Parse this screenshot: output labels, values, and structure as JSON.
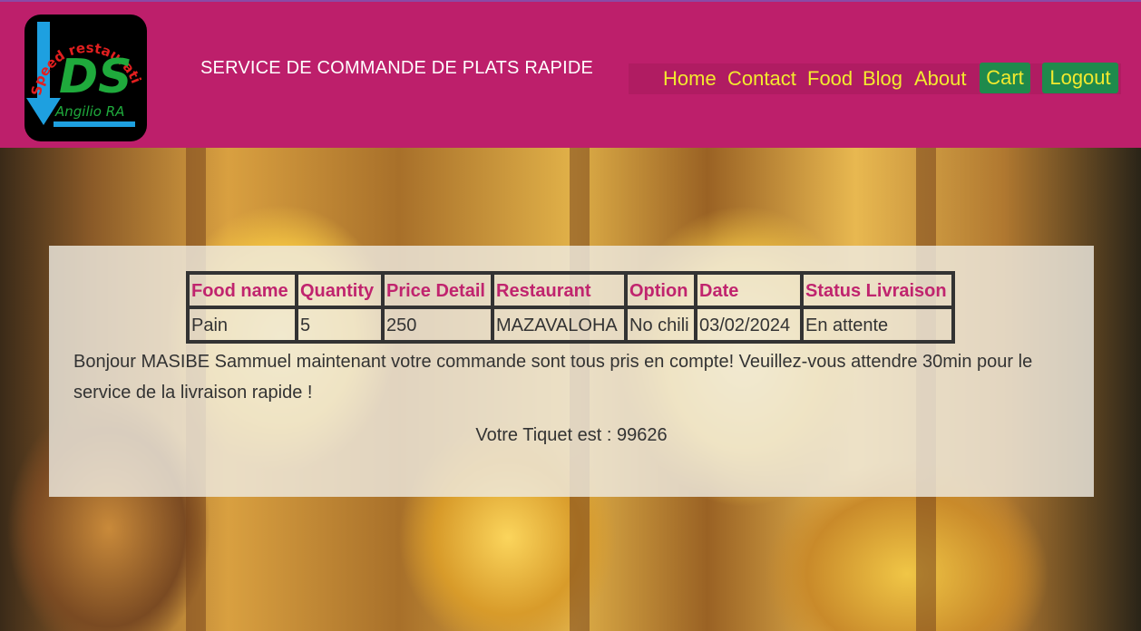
{
  "header": {
    "title": "SERVICE DE COMMANDE DE PLATS RAPIDE",
    "logo": {
      "initials": "DS",
      "arc_text": "Speed restauration",
      "author": "Angilio RA"
    }
  },
  "nav": {
    "home": "Home",
    "contact": "Contact",
    "food": "Food",
    "blog": "Blog",
    "about": "About",
    "cart": "Cart",
    "logout": "Logout"
  },
  "order_table": {
    "headers": [
      "Food name",
      "Quantity",
      "Price Detail",
      "Restaurant",
      "Option",
      "Date",
      "Status Livraison"
    ],
    "rows": [
      [
        "Pain",
        "5",
        "250",
        "MAZAVALOHA",
        "No chili",
        "03/02/2024",
        "En attente"
      ]
    ]
  },
  "confirmation": {
    "message": "Bonjour MASIBE Sammuel maintenant votre commande sont tous pris en compte! Veuillez-vous attendre 30min pour le service de la livraison rapide !",
    "ticket_label": "Votre Tiquet est :",
    "ticket_number": "99626"
  },
  "colors": {
    "header_bg": "#bd1f6b",
    "nav_text": "#f3ea2e",
    "button_bg": "#1f8a4c",
    "table_header_text": "#c0246e"
  }
}
